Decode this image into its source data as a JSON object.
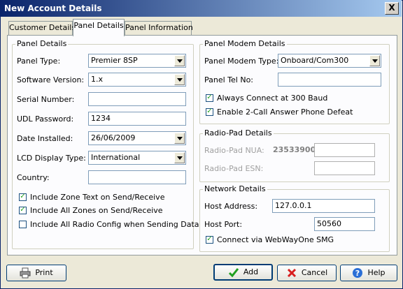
{
  "window": {
    "title": "New Account Details",
    "close_glyph": "X"
  },
  "tabs": [
    {
      "label": "Customer Details",
      "active": false
    },
    {
      "label": "Panel Details",
      "active": true
    },
    {
      "label": "Panel Information",
      "active": false
    }
  ],
  "panel_details": {
    "title": "Panel Details",
    "panel_type": {
      "label": "Panel Type:",
      "value": "Premier 8SP"
    },
    "software_version": {
      "label": "Software Version:",
      "value": "1.x"
    },
    "serial_number": {
      "label": "Serial Number:",
      "value": ""
    },
    "udl_password": {
      "label": "UDL Password:",
      "value": "1234"
    },
    "date_installed": {
      "label": "Date Installed:",
      "value": "26/06/2009"
    },
    "lcd_display_type": {
      "label": "LCD Display Type:",
      "value": "International"
    },
    "country": {
      "label": "Country:",
      "value": ""
    },
    "checks": [
      {
        "label": "Include Zone Text on Send/Receive",
        "checked": true
      },
      {
        "label": "Include All Zones on Send/Receive",
        "checked": true
      },
      {
        "label": "Include All Radio Config when Sending Data",
        "checked": false
      }
    ]
  },
  "panel_modem": {
    "title": "Panel Modem Details",
    "type": {
      "label": "Panel Modem Type:",
      "value": "Onboard/Com300"
    },
    "tel": {
      "label": "Panel Tel No:",
      "value": ""
    },
    "checks": [
      {
        "label": "Always Connect at 300 Baud",
        "checked": true
      },
      {
        "label": "Enable 2-Call Answer Phone Defeat",
        "checked": true
      }
    ]
  },
  "radio_pad": {
    "title": "Radio-Pad Details",
    "nua": {
      "label": "Radio-Pad NUA:",
      "prefix": "23533900",
      "value": ""
    },
    "esn": {
      "label": "Radio-Pad ESN:",
      "value": ""
    }
  },
  "network": {
    "title": "Network Details",
    "host": {
      "label": "Host Address:",
      "value": "127.0.0.1"
    },
    "port": {
      "label": "Host Port:",
      "value": "50560"
    },
    "check": {
      "label": "Connect via WebWayOne SMG",
      "checked": true
    }
  },
  "buttons": {
    "print": "Print",
    "add": "Add",
    "cancel": "Cancel",
    "help": "Help"
  },
  "colors": {
    "title_bar": "#0a246a",
    "face": "#ece9d8",
    "tab_panel": "#fcfcfe"
  }
}
